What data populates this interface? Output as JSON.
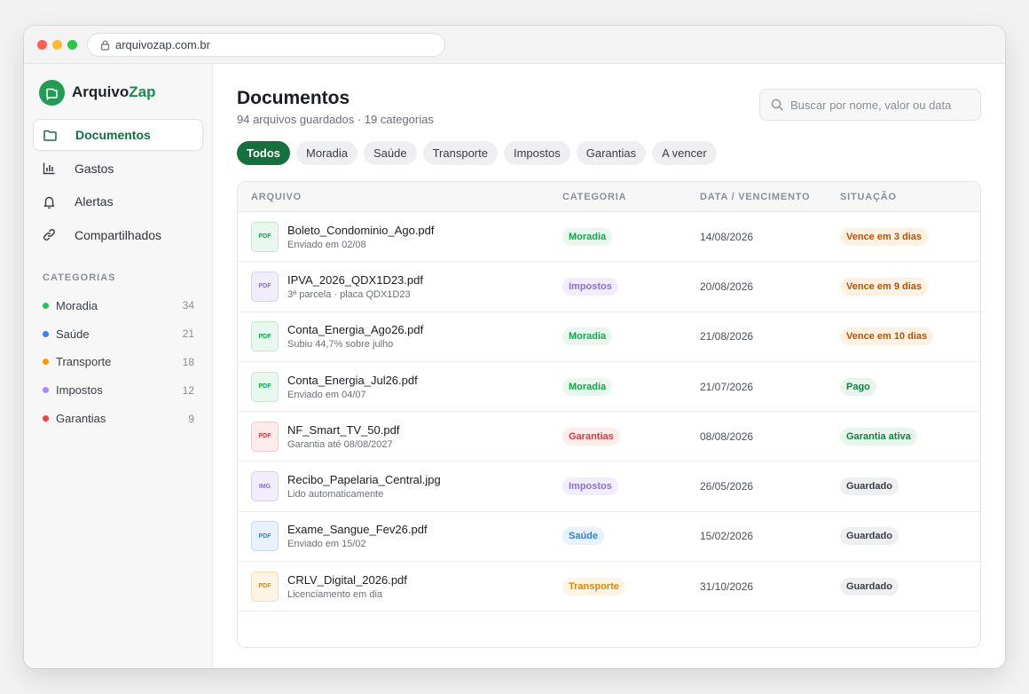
{
  "browser": {
    "url": "arquivozap.com.br"
  },
  "brand": {
    "name_main": "Arquivo",
    "name_accent": "Zap"
  },
  "sidebar": {
    "nav": [
      {
        "label": "Documentos",
        "icon": "folder-icon",
        "active": true
      },
      {
        "label": "Gastos",
        "icon": "bar-chart-icon",
        "active": false
      },
      {
        "label": "Alertas",
        "icon": "bell-icon",
        "active": false
      },
      {
        "label": "Compartilhados",
        "icon": "link-icon",
        "active": false
      }
    ],
    "categories_title": "CATEGORIAS",
    "categories": [
      {
        "label": "Moradia",
        "count": "34",
        "color": "#22c55e"
      },
      {
        "label": "Saúde",
        "count": "21",
        "color": "#3b82f6"
      },
      {
        "label": "Transporte",
        "count": "18",
        "color": "#f59e0b"
      },
      {
        "label": "Impostos",
        "count": "12",
        "color": "#a78bfa"
      },
      {
        "label": "Garantias",
        "count": "9",
        "color": "#ef4444"
      }
    ]
  },
  "header": {
    "title": "Documentos",
    "subtitle": "94 arquivos guardados · 19 categorias",
    "search_placeholder": "Buscar por nome, valor ou data"
  },
  "filters": [
    "Todos",
    "Moradia",
    "Saúde",
    "Transporte",
    "Impostos",
    "Garantias",
    "A vencer"
  ],
  "table": {
    "headers": {
      "file": "ARQUIVO",
      "category": "CATEGORIA",
      "date": "DATA / VENCIMENTO",
      "status": "SITUAÇÃO"
    },
    "rows": [
      {
        "type": "PDF",
        "name": "Boleto_Condominio_Ago.pdf",
        "sub": "Enviado em 02/08",
        "category": "Moradia",
        "date": "14/08/2026",
        "status": "Vence em 3 dias"
      },
      {
        "type": "PDF",
        "name": "IPVA_2026_QDX1D23.pdf",
        "sub": "3ª parcela · placa QDX1D23",
        "category": "Impostos",
        "date": "20/08/2026",
        "status": "Vence em 9 dias"
      },
      {
        "type": "PDF",
        "name": "Conta_Energia_Ago26.pdf",
        "sub": "Subiu 44,7% sobre julho",
        "category": "Moradia",
        "date": "21/08/2026",
        "status": "Vence em 10 dias"
      },
      {
        "type": "PDF",
        "name": "Conta_Energia_Jul26.pdf",
        "sub": "Enviado em 04/07",
        "category": "Moradia",
        "date": "21/07/2026",
        "status": "Pago"
      },
      {
        "type": "PDF",
        "name": "NF_Smart_TV_50.pdf",
        "sub": "Garantia até 08/08/2027",
        "category": "Garantias",
        "date": "08/08/2026",
        "status": "Garantia ativa"
      },
      {
        "type": "IMG",
        "name": "Recibo_Papelaria_Central.jpg",
        "sub": "Lido automaticamente",
        "category": "Impostos",
        "date": "26/05/2026",
        "status": "Guardado"
      },
      {
        "type": "PDF",
        "name": "Exame_Sangue_Fev26.pdf",
        "sub": "Enviado em 15/02",
        "category": "Saúde",
        "date": "15/02/2026",
        "status": "Guardado"
      },
      {
        "type": "PDF",
        "name": "CRLV_Digital_2026.pdf",
        "sub": "Licenciamento em dia",
        "category": "Transporte",
        "date": "31/10/2026",
        "status": "Guardado"
      }
    ]
  },
  "colors": {
    "brand": "#1f9d55",
    "categories": {
      "Moradia": {
        "fg": "#16a34a",
        "bg": "#e9f8ee",
        "border": "#bfe8cd"
      },
      "Impostos": {
        "fg": "#8b6fd6",
        "bg": "#f1edfb",
        "border": "#d9cff3"
      },
      "Garantias": {
        "fg": "#dc3b3b",
        "bg": "#fdecec",
        "border": "#f5c7c7"
      },
      "Saúde": {
        "fg": "#2f7fd8",
        "bg": "#e8f2fc",
        "border": "#c3dbf4"
      },
      "Transporte": {
        "fg": "#d98a0a",
        "bg": "#fdf4e3",
        "border": "#f3dcae"
      }
    },
    "status": {
      "warn": {
        "fg": "#b45309",
        "bg": "#fdf2e2"
      },
      "ok": {
        "fg": "#15803d",
        "bg": "#e6f6ec"
      },
      "neutral": {
        "fg": "#3a3e44",
        "bg": "#eeeff1"
      }
    }
  }
}
